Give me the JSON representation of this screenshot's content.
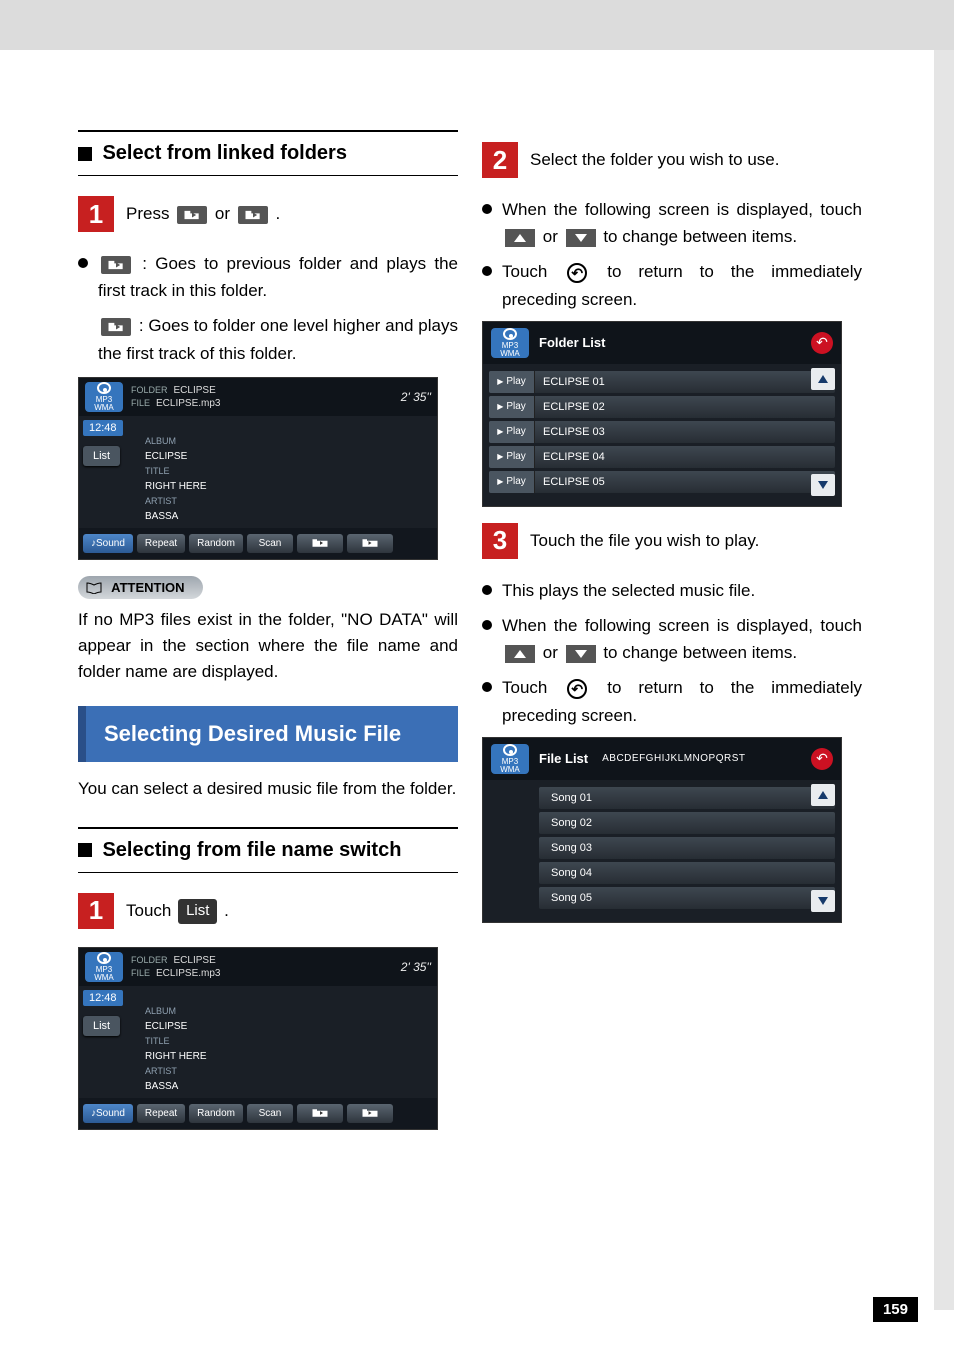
{
  "left": {
    "section1_title": "Select from linked folders",
    "step1_text_a": "Press ",
    "step1_text_b": " or ",
    "step1_text_c": ".",
    "bullet1_pre": " ",
    "bullet1_text": ": Goes to previous folder and plays the first track in this folder.",
    "bullet2_text": ": Goes to folder one level higher and plays the first track of this folder.",
    "attention_label": "ATTENTION",
    "attention_text": "If no MP3 files exist in the folder, \"NO DATA\" will appear in the section where the file name and folder name are displayed.",
    "bluebox": "Selecting Desired Music File",
    "blue_lead": "You can select a desired music file from the folder.",
    "section2_title": "Selecting from file name switch",
    "step1b_text_a": "Touch ",
    "step1b_chip": "List",
    "step1b_text_b": "."
  },
  "right": {
    "step2_text": "Select the folder you wish to use.",
    "r_bullet1": "When the following screen is displayed, touch ",
    "r_bullet1_mid": " or ",
    "r_bullet1_end": " to change between items.",
    "r_bullet2_a": "Touch ",
    "r_bullet2_b": " to return to the immediately preceding screen.",
    "step3_text": "Touch the file you wish to play.",
    "r_bullet3": "This plays the selected music file.",
    "r_bullet4": "When the following screen is displayed, touch ",
    "r_bullet4_mid": " or ",
    "r_bullet4_end": " to change between items.",
    "r_bullet5_a": "Touch ",
    "r_bullet5_b": " to return to the immediately preceding screen."
  },
  "player_shot": {
    "mode_label": "MP3\nWMA",
    "folder_lbl": "FOLDER",
    "folder_val": "ECLIPSE",
    "file_lbl": "FILE",
    "file_val": "ECLIPSE.mp3",
    "time": "2' 35''",
    "clock": "12:48",
    "list_btn": "List",
    "album_lbl": "ALBUM",
    "album_val": "ECLIPSE",
    "title_lbl": "TITLE",
    "title_val": "RIGHT HERE",
    "artist_lbl": "ARTIST",
    "artist_val": "BASSA",
    "foot": {
      "sound": "Sound",
      "repeat": "Repeat",
      "random": "Random",
      "scan": "Scan"
    }
  },
  "folder_list_shot": {
    "title": "Folder List",
    "items": [
      "ECLIPSE 01",
      "ECLIPSE 02",
      "ECLIPSE 03",
      "ECLIPSE 04",
      "ECLIPSE 05"
    ],
    "play": "Play"
  },
  "file_list_shot": {
    "title": "File List",
    "sub": "ABCDEFGHIJKLMNOPQRST",
    "items": [
      "Song 01",
      "Song 02",
      "Song 03",
      "Song 04",
      "Song 05"
    ]
  },
  "page_number": "159"
}
